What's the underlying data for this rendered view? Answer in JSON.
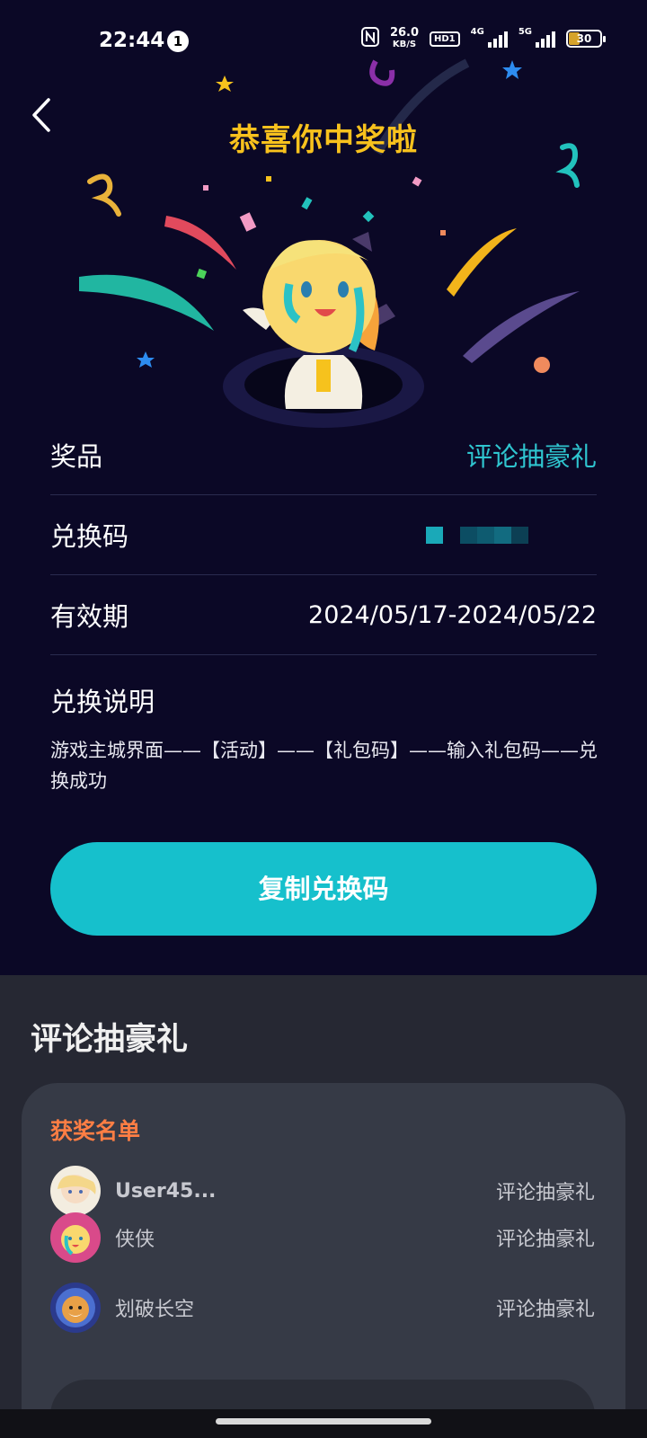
{
  "status_bar": {
    "time": "22:44",
    "notification_count": "1",
    "net_speed": "26.0",
    "net_speed_unit": "KB/S",
    "hd_label": "HD1",
    "net1": "4G",
    "net2": "5G",
    "battery": "30",
    "colors": {
      "battery_fill": "#d6a32a"
    }
  },
  "header": {
    "title": "恭喜你中奖啦"
  },
  "details": {
    "prize_label": "奖品",
    "prize_value": "评论抽豪礼",
    "code_label": "兑换码",
    "validity_label": "有效期",
    "validity_value": "2024/05/17-2024/05/22",
    "instruction_label": "兑换说明",
    "instruction_text": "游戏主城界面——【活动】——【礼包码】——输入礼包码——兑换成功"
  },
  "copy_button": {
    "label": "复制兑换码"
  },
  "activity": {
    "title": "评论抽豪礼",
    "winners_title": "获奖名单",
    "winners": [
      {
        "name": "User45...",
        "prize": "评论抽豪礼"
      },
      {
        "name": "侠侠",
        "prize": "评论抽豪礼"
      },
      {
        "name": "划破长空",
        "prize": "评论抽豪礼"
      }
    ]
  },
  "colors": {
    "accent": "#16c0cc",
    "title": "#f8c21d",
    "winners_title": "#ff7e44",
    "top_bg": "#0b0826",
    "bottom_bg": "#262833"
  }
}
